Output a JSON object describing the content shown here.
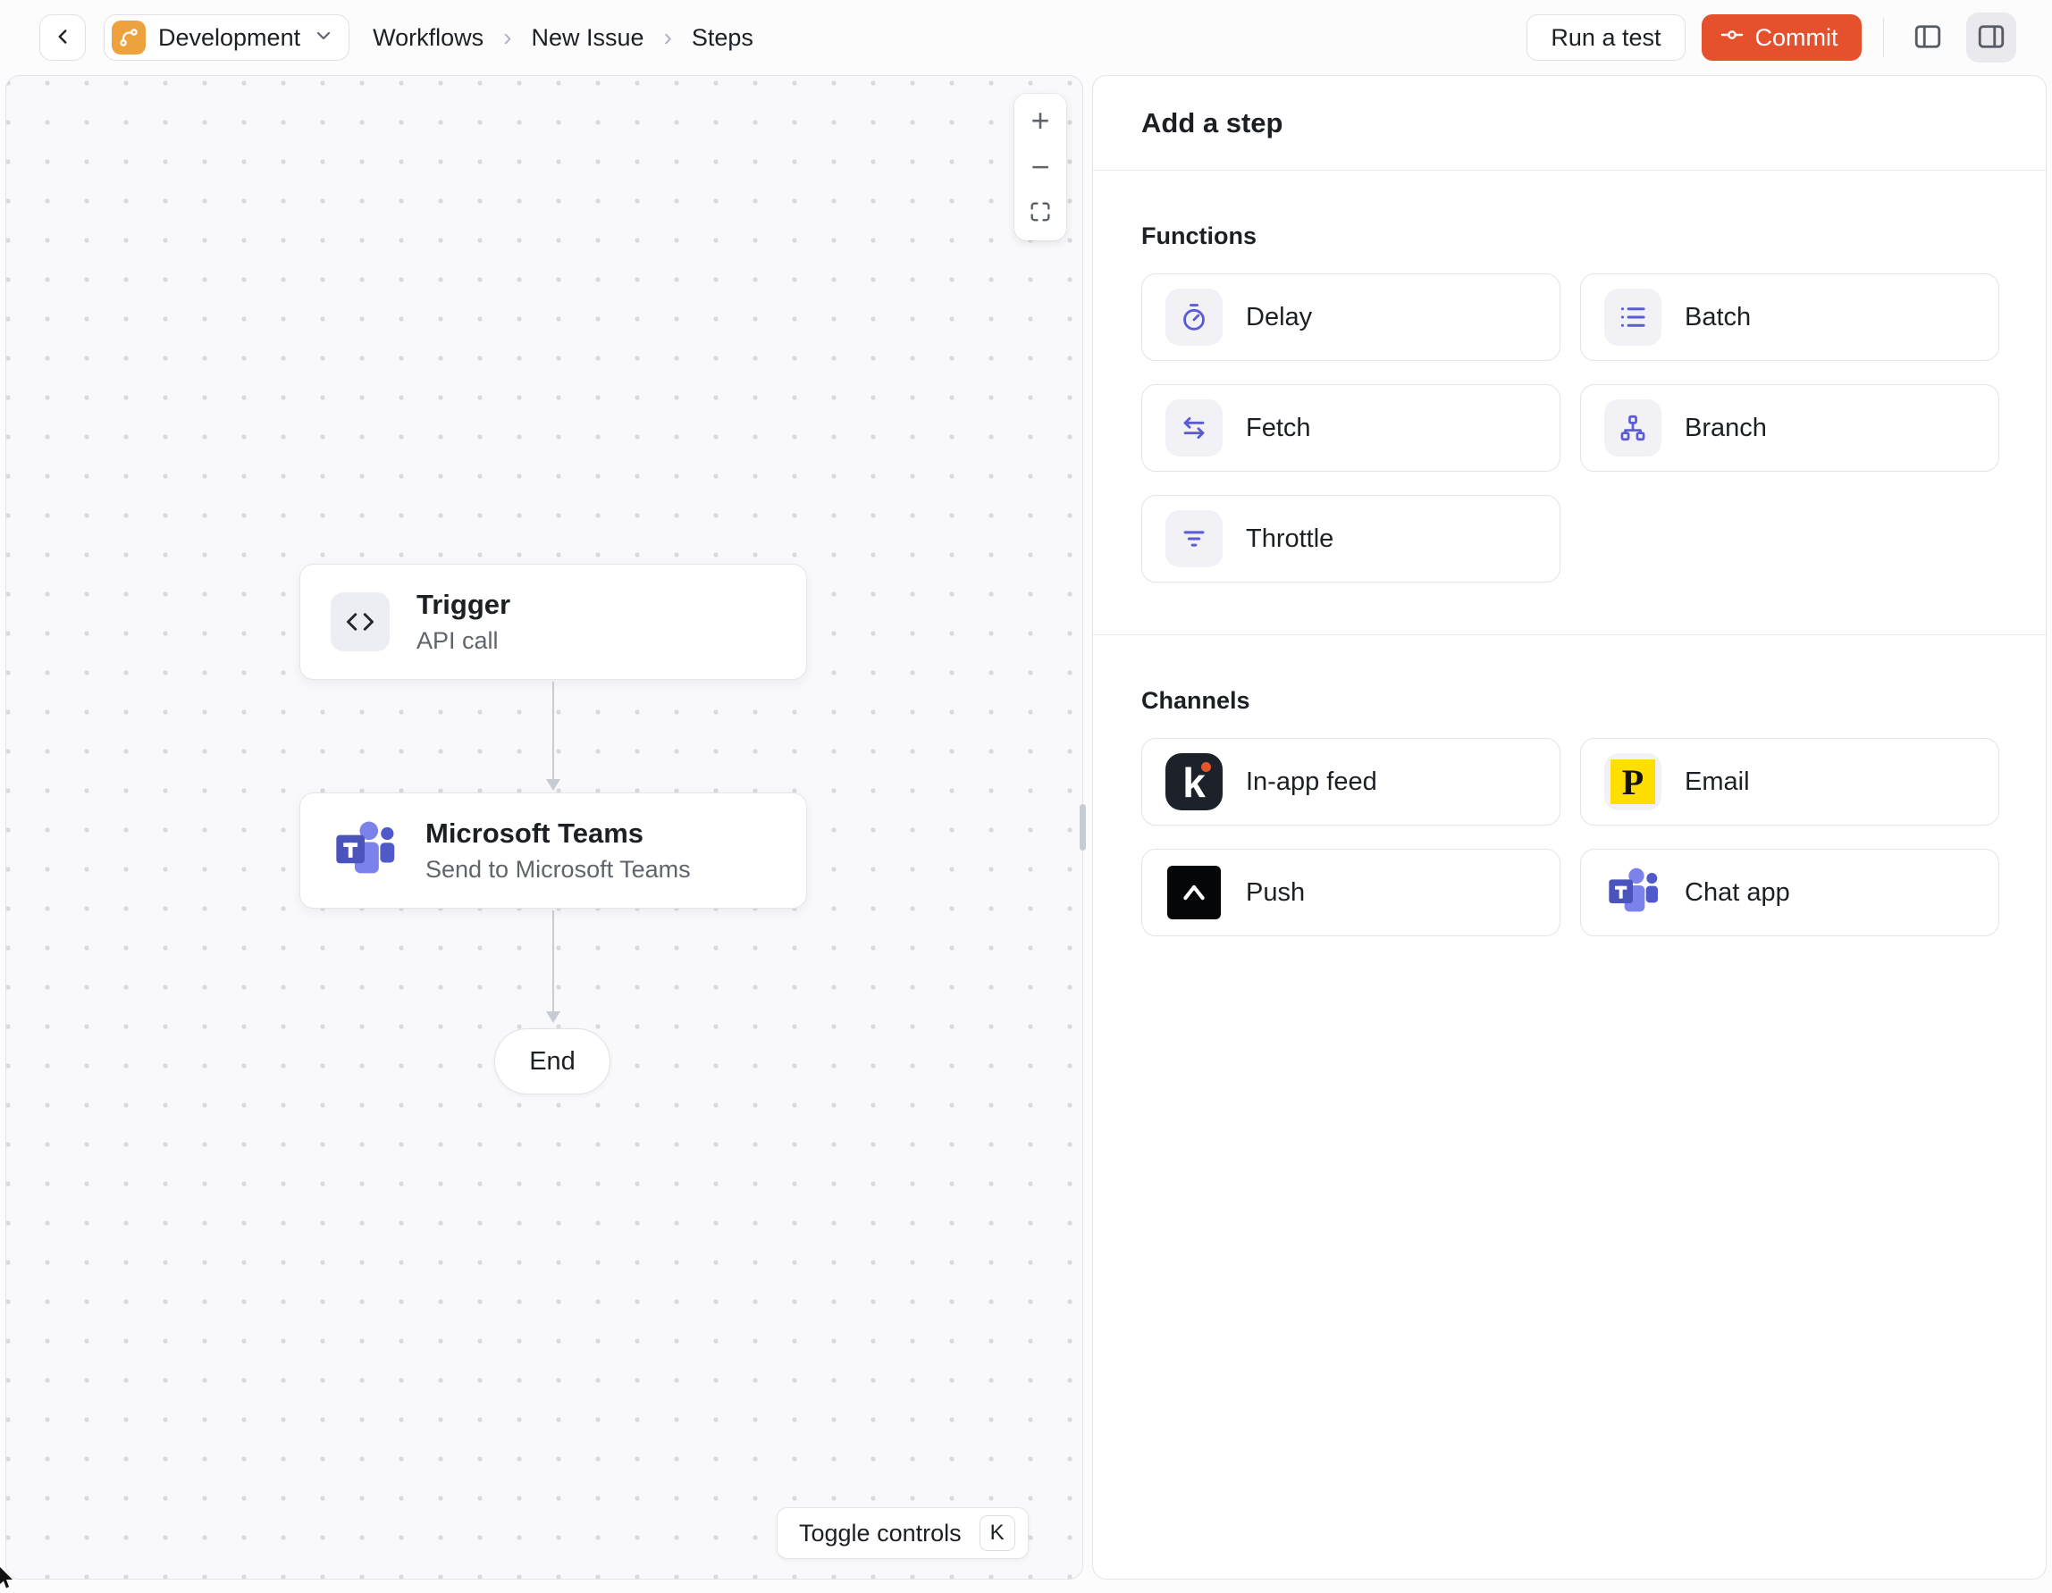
{
  "topbar": {
    "environment": "Development",
    "breadcrumb": [
      "Workflows",
      "New Issue",
      "Steps"
    ],
    "separator": "›",
    "run_test": "Run a test",
    "commit": "Commit"
  },
  "canvas": {
    "trigger": {
      "title": "Trigger",
      "subtitle": "API call",
      "icon": "code-icon"
    },
    "teams_node": {
      "title": "Microsoft Teams",
      "subtitle": "Send to Microsoft Teams",
      "icon": "ms-teams-icon"
    },
    "end_label": "End",
    "zoom_in": "+",
    "zoom_out": "−",
    "fit_icon": "fit-view-icon",
    "toggle_controls": "Toggle controls",
    "shortcut_key": "K"
  },
  "panel": {
    "title": "Add a step",
    "functions": {
      "heading": "Functions",
      "items": [
        {
          "label": "Delay",
          "icon": "stopwatch-icon"
        },
        {
          "label": "Batch",
          "icon": "list-icon"
        },
        {
          "label": "Fetch",
          "icon": "swap-arrows-icon"
        },
        {
          "label": "Branch",
          "icon": "hierarchy-icon"
        },
        {
          "label": "Throttle",
          "icon": "filter-lines-icon"
        }
      ]
    },
    "channels": {
      "heading": "Channels",
      "items": [
        {
          "label": "In-app feed",
          "icon": "knock-icon"
        },
        {
          "label": "Email",
          "icon": "postmark-icon"
        },
        {
          "label": "Push",
          "icon": "expo-icon"
        },
        {
          "label": "Chat app",
          "icon": "ms-teams-icon"
        }
      ]
    }
  },
  "icons": {
    "knock_letter": "k",
    "postmark_letter": "P"
  },
  "colors": {
    "accent_indigo": "#5b5bd6",
    "commit_orange": "#e5512d",
    "environment_amber": "#eea23e",
    "knock_dot_orange": "#e5542b",
    "postmark_yellow": "#ffde00",
    "teams_purple": "#4b53bc",
    "canvas_bg": "#f9f9fb",
    "border_gray": "#e0e1e6",
    "text_primary": "#1c2024",
    "text_secondary": "#60646c"
  }
}
